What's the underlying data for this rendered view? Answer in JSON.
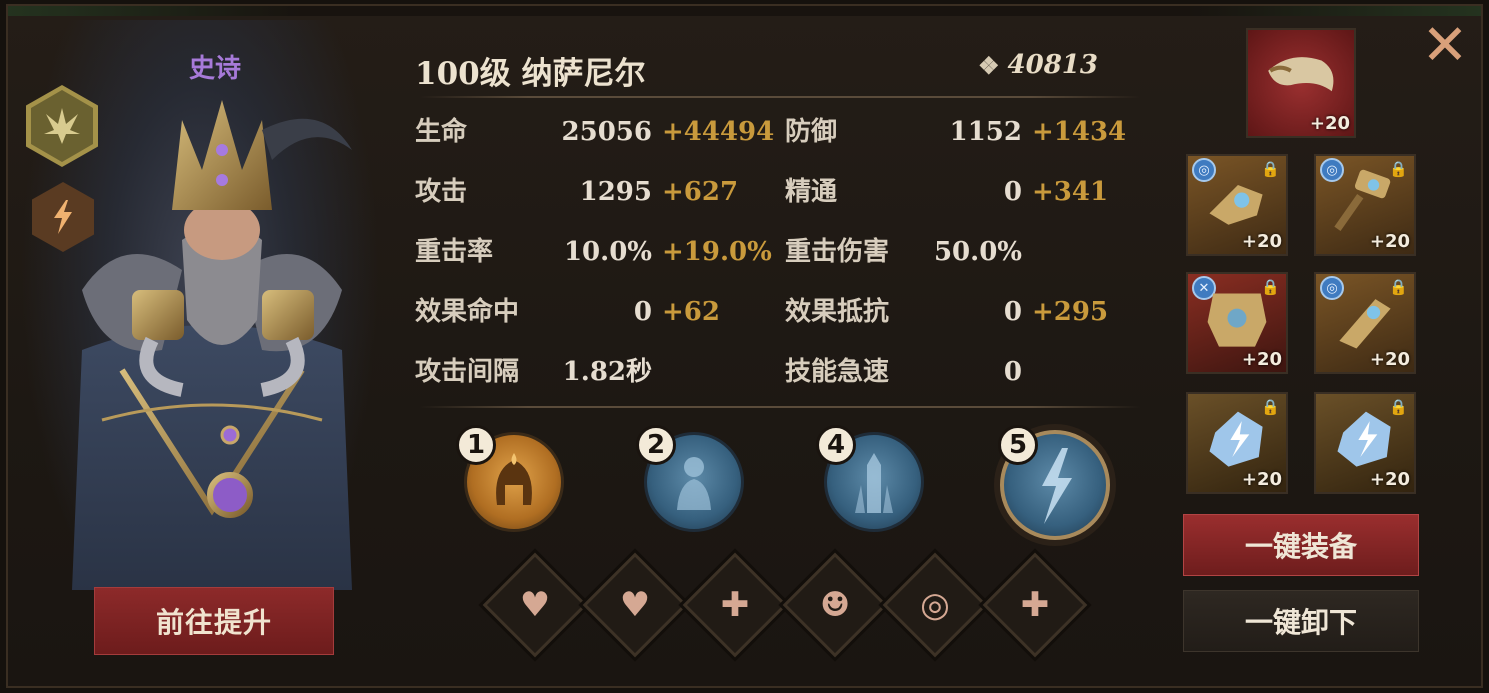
{
  "hero": {
    "rarity": "史诗",
    "level_name": "100级  纳萨尼尔",
    "power": "40813",
    "class_icon": "wing-crest-icon",
    "element_icon": "lightning-icon",
    "upgrade_label": "前往提升"
  },
  "stats": {
    "left": [
      {
        "label": "生命",
        "base": "25056",
        "bonus": "+44494"
      },
      {
        "label": "攻击",
        "base": "1295",
        "bonus": "+627"
      },
      {
        "label": "重击率",
        "base": "10.0%",
        "bonus": "+19.0%"
      },
      {
        "label": "效果命中",
        "base": "0",
        "bonus": "+62"
      },
      {
        "label": "攻击间隔",
        "base": "1.82秒",
        "bonus": ""
      }
    ],
    "right": [
      {
        "label": "防御",
        "base": "1152",
        "bonus": "+1434"
      },
      {
        "label": "精通",
        "base": "0",
        "bonus": "+341"
      },
      {
        "label": "重击伤害",
        "base": "50.0%",
        "bonus": ""
      },
      {
        "label": "效果抵抗",
        "base": "0",
        "bonus": "+295"
      },
      {
        "label": "技能急速",
        "base": "0",
        "bonus": ""
      }
    ]
  },
  "skills": [
    {
      "number": "1",
      "icon": "spartan-helmet-fire-icon",
      "color": "#c98a34"
    },
    {
      "number": "2",
      "icon": "summon-figure-icon",
      "color": "#3f6a8a"
    },
    {
      "number": "4",
      "icon": "ice-totem-icon",
      "color": "#3f6a8a"
    },
    {
      "number": "5",
      "icon": "lightning-burst-icon",
      "color": "#3f6a8a"
    }
  ],
  "traits": [
    {
      "icon": "heart-icon",
      "glyph": "♥"
    },
    {
      "icon": "heart-ripple-icon",
      "glyph": "♥"
    },
    {
      "icon": "sprout-plus-icon",
      "glyph": "✚"
    },
    {
      "icon": "face-aura-icon",
      "glyph": "☻"
    },
    {
      "icon": "swirl-icon",
      "glyph": "◎"
    },
    {
      "icon": "sprout-plus-icon",
      "glyph": "✚"
    }
  ],
  "equipment": {
    "weapon": {
      "level": "+20",
      "icon": "horn-weapon-icon"
    },
    "items": [
      {
        "level": "+20",
        "icon": "gauntlet-icon",
        "locked": true,
        "set": true,
        "bg": "#6a4a22"
      },
      {
        "level": "+20",
        "icon": "hammer-icon",
        "locked": true,
        "set": true,
        "bg": "#6a4a22"
      },
      {
        "level": "+20",
        "icon": "armor-chest-icon",
        "locked": true,
        "set": true,
        "bg": "#6b2a1f"
      },
      {
        "level": "+20",
        "icon": "bracer-icon",
        "locked": true,
        "set": true,
        "bg": "#6a4a22"
      },
      {
        "level": "+20",
        "icon": "lightning-crystal-icon",
        "locked": true,
        "set": false,
        "bg": "#5c4424"
      },
      {
        "level": "+20",
        "icon": "lightning-crystal-icon",
        "locked": true,
        "set": false,
        "bg": "#5c4424"
      }
    ],
    "equip_all_label": "一键装备",
    "unequip_all_label": "一键卸下"
  },
  "colors": {
    "rarity": "#a77ad9",
    "bonus": "#c99a3c",
    "primary_button": "#8d2a2a"
  }
}
